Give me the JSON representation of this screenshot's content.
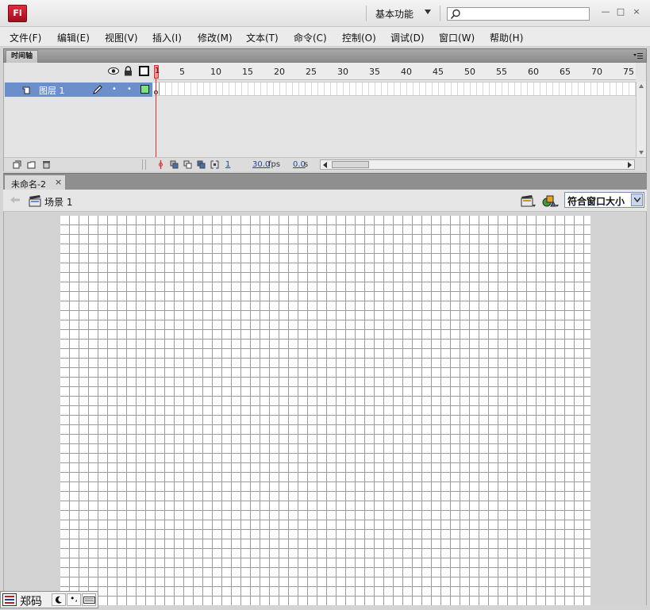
{
  "titlebar": {
    "logo_text": "Fl",
    "workspace": "基本功能",
    "search_placeholder": "",
    "minimize": "—",
    "maximize": "□",
    "close": "×"
  },
  "menu": [
    "文件(F)",
    "编辑(E)",
    "视图(V)",
    "插入(I)",
    "修改(M)",
    "文本(T)",
    "命令(C)",
    "控制(O)",
    "调试(D)",
    "窗口(W)",
    "帮助(H)"
  ],
  "timeline": {
    "panel_title": "时间轴",
    "ruler_labels": [
      "1",
      "5",
      "10",
      "15",
      "20",
      "25",
      "30",
      "35",
      "40",
      "45",
      "50",
      "55",
      "60",
      "65",
      "70",
      "75"
    ],
    "layers": [
      {
        "name": "图层 1"
      }
    ],
    "current_frame": "1",
    "fps": "30.0",
    "fps_unit": "fps",
    "elapsed": "0.0",
    "elapsed_unit": "s"
  },
  "document": {
    "tab_title": "未命名-2",
    "tab_close": "×",
    "scene_label": "场景 1",
    "zoom": "符合窗口大小"
  },
  "ime": {
    "name": "郑码"
  },
  "colors": {
    "layer_selected": "#6c8fcc",
    "playhead": "#d43434",
    "logo_red": "#d01a2e",
    "keyframe_fill": "#7ee07e"
  }
}
